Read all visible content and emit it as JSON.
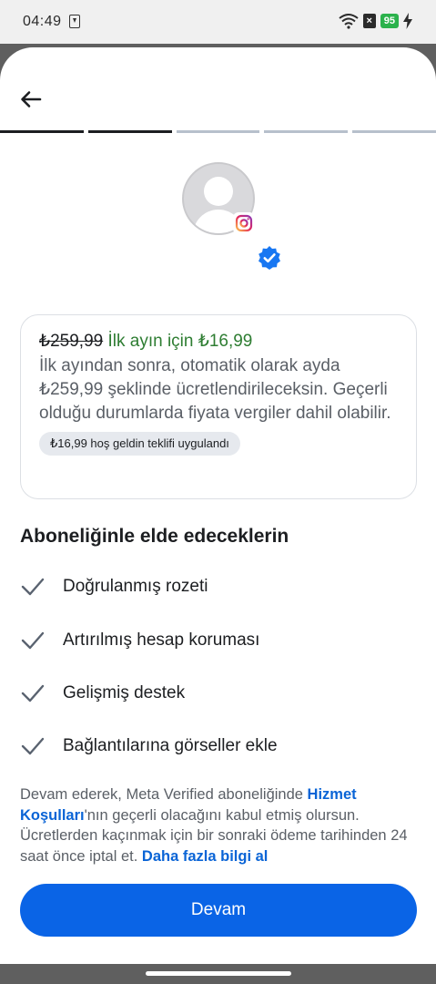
{
  "status_bar": {
    "time": "04:49",
    "battery": "95"
  },
  "progress": {
    "total_steps": 5,
    "completed_steps": 2,
    "active_color": "#1c1e21",
    "inactive_color": "#b7c0cc"
  },
  "offer": {
    "old_price": "₺259,99",
    "promo_text": "İlk ayın için ₺16,99",
    "description": "İlk ayından sonra, otomatik olarak ayda ₺259,99 şeklinde ücretlendirileceksin. Geçerli olduğu durumlarda fiyata vergiler dahil olabilir.",
    "chip": "₺16,99 hoş geldin teklifi uygulandı"
  },
  "benefits": {
    "title": "Aboneliğinle elde edeceklerin",
    "items": [
      {
        "label": "Doğrulanmış rozeti"
      },
      {
        "label": "Artırılmış hesap koruması"
      },
      {
        "label": "Gelişmiş destek"
      },
      {
        "label": "Bağlantılarına görseller ekle"
      }
    ]
  },
  "terms": {
    "part1": "Devam ederek, Meta Verified aboneliğinde ",
    "link1": "Hizmet Koşulları",
    "part2": "'nın geçerli olacağını kabul etmiş olursun. Ücretlerden kaçınmak için bir sonraki ödeme tarihinden 24 saat önce iptal et. ",
    "link2": "Daha fazla bilgi al"
  },
  "continue_button": {
    "label": "Devam"
  },
  "colors": {
    "accent": "#0a64e6",
    "promo_green": "#2e7d32",
    "verified_blue": "#1877f2"
  },
  "icons": {
    "back": "arrow-left-icon",
    "check": "check-icon",
    "verified": "verified-badge-icon",
    "instagram": "instagram-icon"
  }
}
